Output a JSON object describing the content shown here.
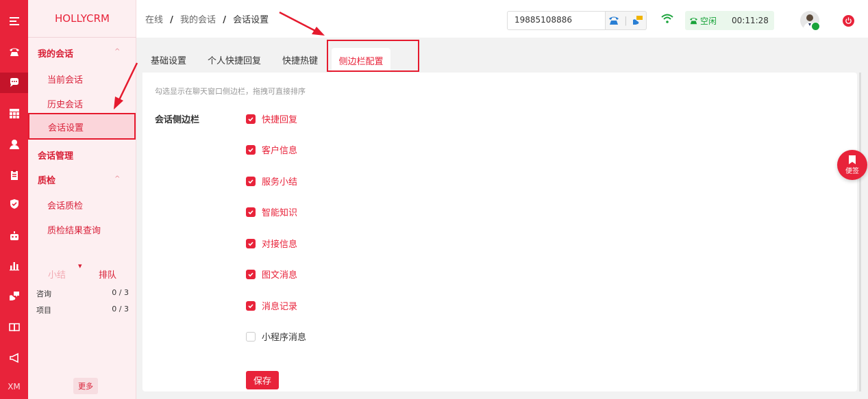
{
  "colors": {
    "accent": "#e8233a",
    "rail": "#e8233a",
    "nav_bg": "#fdeff1",
    "success": "#19a33a",
    "annotation": "#e51a2e"
  },
  "rail": {
    "icons": [
      "menu-icon",
      "phone-icon",
      "chat-icon",
      "grid-icon",
      "user-icon",
      "clipboard-icon",
      "shield-icon",
      "robot-icon",
      "bar-chart-icon",
      "comment-icon",
      "book-icon",
      "megaphone-icon"
    ],
    "footer": "XM"
  },
  "nav": {
    "brand": "HOLLYCRM",
    "groups": [
      {
        "label": "我的会话",
        "chevron": "^",
        "items": [
          "当前会话",
          "历史会话",
          "会话设置"
        ]
      },
      {
        "label": "会话管理"
      },
      {
        "label": "质检",
        "chevron": "^",
        "items": [
          "会话质检",
          "质检结果查询"
        ]
      }
    ],
    "queue": {
      "tab_summary": "小结",
      "tab_queue": "排队",
      "rows": [
        {
          "name": "咨询",
          "value": "0 / 3"
        },
        {
          "name": "项目",
          "value": "0 / 3"
        }
      ]
    },
    "more": "更多"
  },
  "header": {
    "breadcrumb": [
      "在线",
      "我的会话",
      "会话设置"
    ],
    "separator": "/",
    "phone": "19885108886",
    "status": "空闲",
    "timer": "00:11:28"
  },
  "tabs": [
    "基础设置",
    "个人快捷回复",
    "快捷热键",
    "侧边栏配置"
  ],
  "panel": {
    "hint": "勾选显示在聊天窗口侧边栏，拖拽可直接排序",
    "field_label": "会话侧边栏",
    "options": [
      {
        "label": "快捷回复",
        "checked": true
      },
      {
        "label": "客户信息",
        "checked": true
      },
      {
        "label": "服务小结",
        "checked": true
      },
      {
        "label": "智能知识",
        "checked": true
      },
      {
        "label": "对接信息",
        "checked": true
      },
      {
        "label": "图文消息",
        "checked": true
      },
      {
        "label": "消息记录",
        "checked": true
      },
      {
        "label": "小程序消息",
        "checked": false
      }
    ],
    "save": "保存"
  },
  "float": {
    "label": "便签"
  }
}
